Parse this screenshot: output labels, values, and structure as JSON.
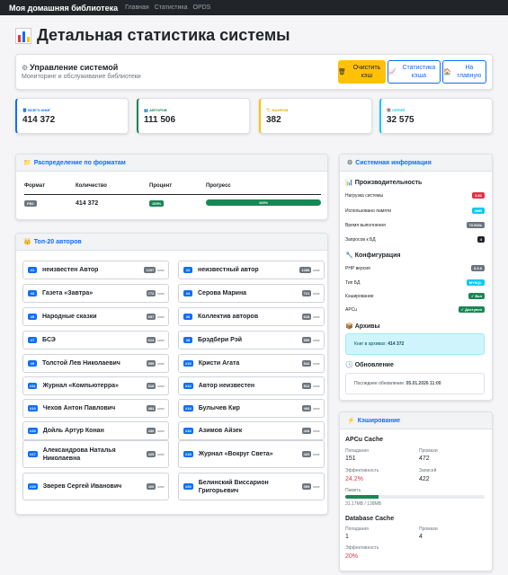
{
  "navbar": {
    "brand": "Моя домашняя библиотека",
    "links": [
      "Главная",
      "Статистика",
      "OPDS"
    ]
  },
  "page": {
    "title": "Детальная статистика системы"
  },
  "management": {
    "title": "Управление системой",
    "subtitle": "Мониторинг и обслуживание библиотеки",
    "buttons": {
      "clear_cache": "Очистить кэш",
      "cache_stats": "Статистика кэша",
      "home": "На главную"
    }
  },
  "stats": [
    {
      "label": "Всего книг",
      "value": "414 372",
      "color": "#0d6efd"
    },
    {
      "label": "Авторов",
      "value": "111 506",
      "color": "#198754"
    },
    {
      "label": "Жанров",
      "value": "382",
      "color": "#ffc107"
    },
    {
      "label": "Серий",
      "value": "32 575",
      "color": "#0dcaf0"
    }
  ],
  "formats": {
    "title": "Распределение по форматам",
    "headers": [
      "Формат",
      "Количество",
      "Процент",
      "Прогресс"
    ],
    "rows": [
      {
        "format": "FB2",
        "count": "414 372",
        "percent": "100%",
        "progress": 1.0,
        "progress_label": "100%"
      }
    ]
  },
  "authors": {
    "title": "Топ-20 авторов",
    "unit": "книг",
    "items": [
      {
        "rank": "#1",
        "name": "неизвестен Автор",
        "count": "1207"
      },
      {
        "rank": "#2",
        "name": "неизвестный автор",
        "count": "1288"
      },
      {
        "rank": "#3",
        "name": "Газета «Завтра»",
        "count": "772"
      },
      {
        "rank": "#4",
        "name": "Серова Марина",
        "count": "721"
      },
      {
        "rank": "#5",
        "name": "Народные сказки",
        "count": "657"
      },
      {
        "rank": "#6",
        "name": "Коллектив авторов",
        "count": "618"
      },
      {
        "rank": "#7",
        "name": "БСЭ",
        "count": "614"
      },
      {
        "rank": "#8",
        "name": "Брэдбери Рэй",
        "count": "555"
      },
      {
        "rank": "#9",
        "name": "Толстой Лев Николаевич",
        "count": "555"
      },
      {
        "rank": "#10",
        "name": "Кристи Агата",
        "count": "542"
      },
      {
        "rank": "#11",
        "name": "Журнал «Компьютерра»",
        "count": "518"
      },
      {
        "rank": "#12",
        "name": "Автор неизвестен",
        "count": "512"
      },
      {
        "rank": "#13",
        "name": "Чехов Антон Павлович",
        "count": "484"
      },
      {
        "rank": "#14",
        "name": "Булычев Кир",
        "count": "468"
      },
      {
        "rank": "#15",
        "name": "Дойль Артур Конан",
        "count": "436"
      },
      {
        "rank": "#16",
        "name": "Азимов Айзек",
        "count": "426"
      },
      {
        "rank": "#17",
        "name": "Александрова Наталья Николаевна",
        "count": "425"
      },
      {
        "rank": "#18",
        "name": "Журнал «Вокруг Света»",
        "count": "420"
      },
      {
        "rank": "#19",
        "name": "Зверев Сергей Иванович",
        "count": "420"
      },
      {
        "rank": "#20",
        "name": "Белинский Виссарион Григорьевич",
        "count": "399"
      }
    ]
  },
  "system": {
    "title": "Системная информация",
    "performance": {
      "title": "Производительность",
      "rows": [
        {
          "label": "Нагрузка системы",
          "value": "2.81",
          "color": "#dc3545"
        },
        {
          "label": "Использовано памяти",
          "value": "2MB",
          "color": "#0dcaf0"
        },
        {
          "label": "Время выполнения",
          "value": "70.518s",
          "color": "#6c757d"
        },
        {
          "label": "Запросов к БД",
          "value": "4",
          "color": "#212529"
        }
      ]
    },
    "config": {
      "title": "Конфигурация",
      "rows": [
        {
          "label": "PHP версия",
          "value": "8.3.6",
          "color": "#6c757d"
        },
        {
          "label": "Тип БД",
          "value": "MYSQL",
          "color": "#0dcaf0"
        },
        {
          "label": "Кэширование",
          "value": "✓ Вкл",
          "color": "#198754"
        },
        {
          "label": "APCu",
          "value": "✓ Доступен",
          "color": "#198754"
        }
      ]
    },
    "archives": {
      "title": "Архивы",
      "text": "Книг в архивах:",
      "value": "414 372"
    },
    "update": {
      "title": "Обновление",
      "text": "Последнее обновление:",
      "value": "05.01.2026 11:00"
    }
  },
  "caching": {
    "title": "Кэширование",
    "apcu": {
      "title": "APCu Cache",
      "hits_label": "Попадания",
      "hits": "151",
      "misses_label": "Промахи",
      "misses": "472",
      "eff_label": "Эффективность",
      "eff": "24.2%",
      "entries_label": "Записей",
      "entries": "422",
      "memory_label": "Память",
      "memory": "31.17MB / 128MB",
      "memory_fraction": 0.24
    },
    "db": {
      "title": "Database Cache",
      "hits_label": "Попадания",
      "hits": "1",
      "misses_label": "Промахи",
      "misses": "4",
      "eff_label": "Эффективность",
      "eff": "20%"
    }
  }
}
